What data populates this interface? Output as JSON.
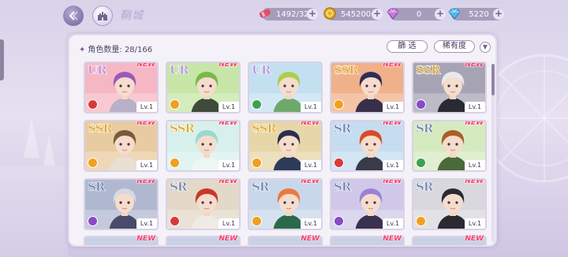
{
  "header": {
    "title": "鞘城",
    "resources": [
      {
        "name": "stamina",
        "value": "1492/32",
        "icon": "candy-icon",
        "color": "#e0506a"
      },
      {
        "name": "gold",
        "value": "545200",
        "icon": "coin-icon",
        "color": "#e8b030"
      },
      {
        "name": "gem-paid",
        "value": "0",
        "icon": "diamond-icon",
        "color": "#c87ad8"
      },
      {
        "name": "gem-free",
        "value": "5220",
        "icon": "crystal-icon",
        "color": "#52b9ea"
      }
    ],
    "plus_label": "+"
  },
  "panel": {
    "count_label": "角色数量: 28/166",
    "filter_label": "篩 选",
    "rarity_label": "稀有度",
    "sort_icon": "chevron-down-icon"
  },
  "colors": {
    "new": "#ff3d6e",
    "ur": "#b588e0",
    "ssr": "#e2a62a",
    "sr": "#6b7fb0"
  },
  "cards": [
    {
      "rarity": "UR",
      "new": "NEW",
      "level": "Lv.1",
      "element": "#d83a3a",
      "hair": "#9a5ab8",
      "bg": "#f6b7c5",
      "outfit": "#b8b0c8"
    },
    {
      "rarity": "UR",
      "new": "NEW",
      "level": "Lv.1",
      "element": "#f0a020",
      "hair": "#7ab84a",
      "bg": "#c7e6a8",
      "outfit": "#3f4a3a"
    },
    {
      "rarity": "UR",
      "new": "",
      "level": "Lv.1",
      "element": "#3fa050",
      "hair": "#a8d04a",
      "bg": "#c4e0f0",
      "outfit": "#6ea86a"
    },
    {
      "rarity": "SSR",
      "new": "NEW",
      "level": "Lv.1",
      "element": "#f0a020",
      "hair": "#2e2e55",
      "bg": "#f0b08a",
      "outfit": "#3a2f4a"
    },
    {
      "rarity": "SSR",
      "new": "NEW",
      "level": "Lv.1",
      "element": "#8a4ac8",
      "hair": "#e8e8ee",
      "bg": "#a6a4b4",
      "outfit": "#2a2a33"
    },
    {
      "rarity": "SSR",
      "new": "NEW",
      "level": "Lv.1",
      "element": "#f0a020",
      "hair": "#7a5a3a",
      "bg": "#e8cba0",
      "outfit": "#e8e0d2"
    },
    {
      "rarity": "SSR",
      "new": "NEW",
      "level": "Lv.1",
      "element": "#f0a020",
      "hair": "#9ad8d0",
      "bg": "#d8f0ec",
      "outfit": "#eef6f4"
    },
    {
      "rarity": "SSR",
      "new": "NEW",
      "level": "Lv.1",
      "element": "#f0a020",
      "hair": "#2a2e52",
      "bg": "#e6d6a8",
      "outfit": "#2d3a5a"
    },
    {
      "rarity": "SR",
      "new": "NEW",
      "level": "Lv.1",
      "element": "#d83a3a",
      "hair": "#d84a2a",
      "bg": "#c6dcef",
      "outfit": "#3a3a48"
    },
    {
      "rarity": "SR",
      "new": "NEW",
      "level": "Lv.1",
      "element": "#3fa050",
      "hair": "#a8602a",
      "bg": "#d6eac0",
      "outfit": "#4a6a3a"
    },
    {
      "rarity": "SR",
      "new": "NEW",
      "level": "Lv.1",
      "element": "#8a4ac8",
      "hair": "#d8d8e2",
      "bg": "#b0b8d0",
      "outfit": "#4a4a6a"
    },
    {
      "rarity": "SR",
      "new": "NEW",
      "level": "Lv.1",
      "element": "#d83a3a",
      "hair": "#c8382a",
      "bg": "#e4d8c8",
      "outfit": "#f0ece4"
    },
    {
      "rarity": "SR",
      "new": "NEW",
      "level": "Lv.1",
      "element": "#f0a020",
      "hair": "#e87a40",
      "bg": "#c8d8ea",
      "outfit": "#2a6a4a"
    },
    {
      "rarity": "SR",
      "new": "NEW",
      "level": "Lv.1",
      "element": "#8a4ac8",
      "hair": "#9a82d8",
      "bg": "#d0c8e8",
      "outfit": "#3a3050"
    },
    {
      "rarity": "SR",
      "new": "NEW",
      "level": "Lv.1",
      "element": "#f0a020",
      "hair": "#2a2a30",
      "bg": "#d8d8de",
      "outfit": "#2a2a30"
    }
  ],
  "partial_cards": [
    {
      "new": "NEW"
    },
    {
      "new": "NEW"
    },
    {
      "new": "NEW"
    },
    {
      "new": "NEW"
    },
    {
      "new": "NEW"
    }
  ]
}
